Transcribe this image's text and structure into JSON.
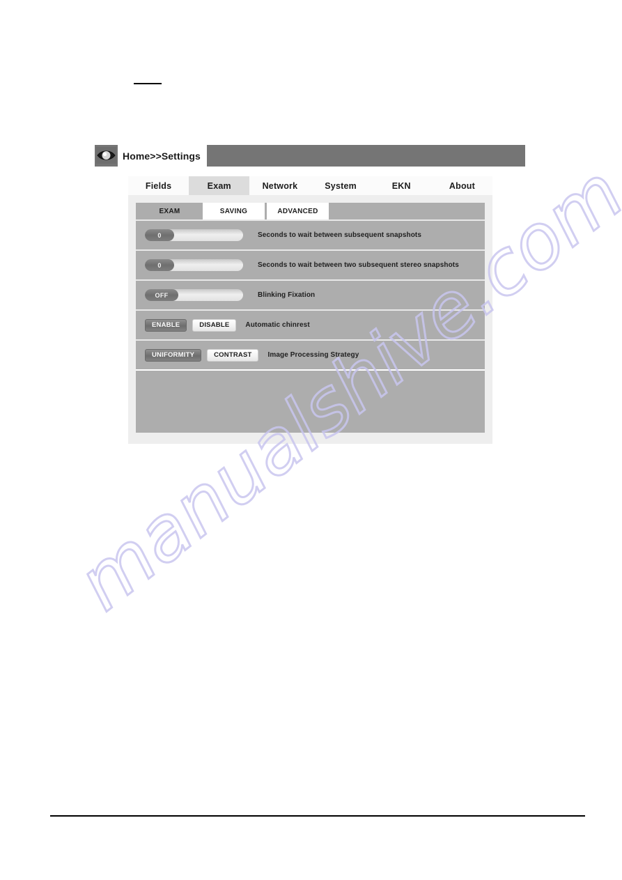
{
  "header": {
    "icon": "eye-icon",
    "breadcrumb_home": "Home",
    "breadcrumb_separator": " >> ",
    "breadcrumb_current": "Settings",
    "background_color": "#757575"
  },
  "tabs": [
    {
      "label": "Fields",
      "active": false
    },
    {
      "label": "Exam",
      "active": true
    },
    {
      "label": "Network",
      "active": false
    },
    {
      "label": "System",
      "active": false
    },
    {
      "label": "EKN",
      "active": false
    },
    {
      "label": "About",
      "active": false
    }
  ],
  "subtabs": [
    {
      "label": "EXAM",
      "active": true
    },
    {
      "label": "SAVING",
      "active": false
    },
    {
      "label": "ADVANCED",
      "active": false
    }
  ],
  "rows": [
    {
      "type": "slider",
      "value": "0",
      "label": "Seconds to wait between subsequent snapshots"
    },
    {
      "type": "slider",
      "value": "0",
      "label": "Seconds to wait between two subsequent stereo snapshots"
    },
    {
      "type": "slider",
      "value": "OFF",
      "label": "Blinking Fixation"
    },
    {
      "type": "buttons",
      "option_a": "ENABLE",
      "option_b": "DISABLE",
      "selected": "ENABLE",
      "label": "Automatic chinrest"
    },
    {
      "type": "buttons",
      "option_a": "UNIFORMITY",
      "option_b": "CONTRAST",
      "selected": "UNIFORMITY",
      "label": "Image Processing Strategy"
    }
  ],
  "watermark": {
    "text": "manualshive.com",
    "color": "#c9c6ef"
  },
  "colors": {
    "header_bar": "#757575",
    "panel_outer": "#eeeeee",
    "panel_inner": "#adadad",
    "tab_active": "#dcdcdc",
    "tab_inactive": "#fbfbfb",
    "button_selected": "#7a7a7a",
    "button_unselected": "#f3f3f3"
  }
}
